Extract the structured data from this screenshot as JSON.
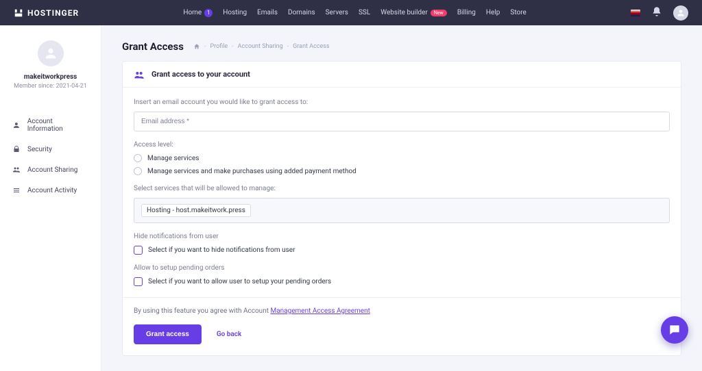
{
  "brand": "HOSTINGER",
  "top_nav": {
    "home": "Home",
    "home_badge": "1",
    "hosting": "Hosting",
    "emails": "Emails",
    "domains": "Domains",
    "servers": "Servers",
    "ssl": "SSL",
    "builder": "Website builder",
    "builder_badge": "New",
    "billing": "Billing",
    "help": "Help",
    "store": "Store"
  },
  "profile": {
    "name": "makeitworkpress",
    "member": "Member since: 2021-04-21"
  },
  "sidebar": {
    "items": [
      {
        "label": "Account Information"
      },
      {
        "label": "Security"
      },
      {
        "label": "Account Sharing"
      },
      {
        "label": "Account Activity"
      }
    ]
  },
  "breadcrumb": {
    "profile": "Profile",
    "sharing": "Account Sharing",
    "current": "Grant Access"
  },
  "page": {
    "title": "Grant Access",
    "card_title": "Grant access to your account",
    "email_hint": "Insert an email account you would like to grant access to:",
    "email_placeholder": "Email address *",
    "access_level_label": "Access level:",
    "access_opt1": "Manage services",
    "access_opt2": "Manage services and make purchases using added payment method",
    "services_label": "Select services that will be allowed to manage:",
    "service_chip": "Hosting - host.makeitwork.press",
    "hide_notif_label": "Hide notifications from user",
    "hide_notif_check": "Select if you want to hide notifications from user",
    "pending_label": "Allow to setup pending orders",
    "pending_check": "Select if you want to allow user to setup your pending orders",
    "agreement_pre": "By using this feature you agree with Account ",
    "agreement_link": "Management Access Agreement",
    "btn_primary": "Grant access",
    "btn_secondary": "Go back"
  }
}
